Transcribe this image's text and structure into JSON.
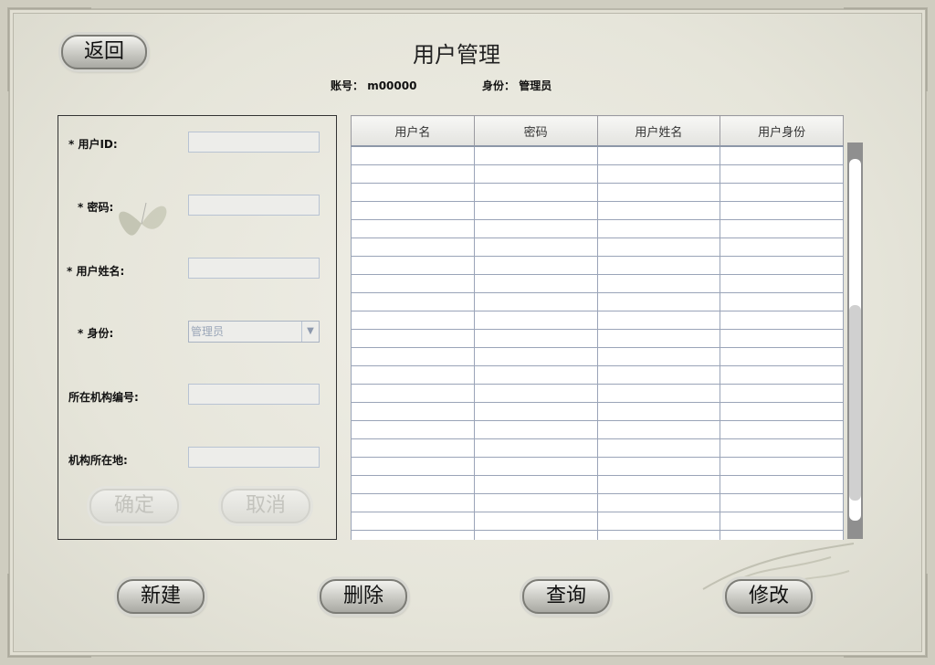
{
  "header": {
    "title": "用户管理",
    "back_label": "返回",
    "account_label": "账号：",
    "account_value": "m00000",
    "role_label": "身份：",
    "role_value": "管理员"
  },
  "form": {
    "user_id_label": "* 用户ID:",
    "password_label": "* 密码:",
    "real_name_label": "* 用户姓名:",
    "role_label": "* 身份:",
    "role_selected": "管理员",
    "org_no_label": "所在机构编号:",
    "org_location_label": "机构所在地:",
    "confirm_label": "确定",
    "cancel_label": "取消"
  },
  "table": {
    "columns": [
      "用户名",
      "密码",
      "用户姓名",
      "用户身份"
    ],
    "empty_rows": 22
  },
  "actions": {
    "new_label": "新建",
    "delete_label": "删除",
    "query_label": "查询",
    "modify_label": "修改"
  }
}
